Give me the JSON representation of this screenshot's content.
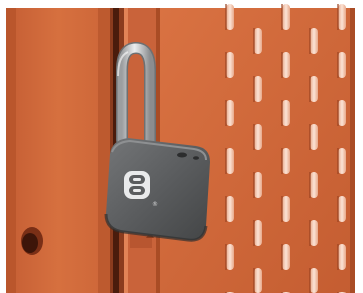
{
  "photo": {
    "subject": "padlock-on-locker",
    "colors": {
      "locker_orange": "#d0673b",
      "locker_dark": "#8a3a1d",
      "locker_shadow": "#b4532c",
      "lock_body": "#5b5d5e",
      "lock_highlight": "#7b7d7e",
      "shackle": "#c9cbcd",
      "slot_highlight": "#f3c7b0",
      "frame_white": "#ffffff"
    },
    "logo": {
      "icon": "figure-eight-logo-icon",
      "mark": "®"
    }
  }
}
